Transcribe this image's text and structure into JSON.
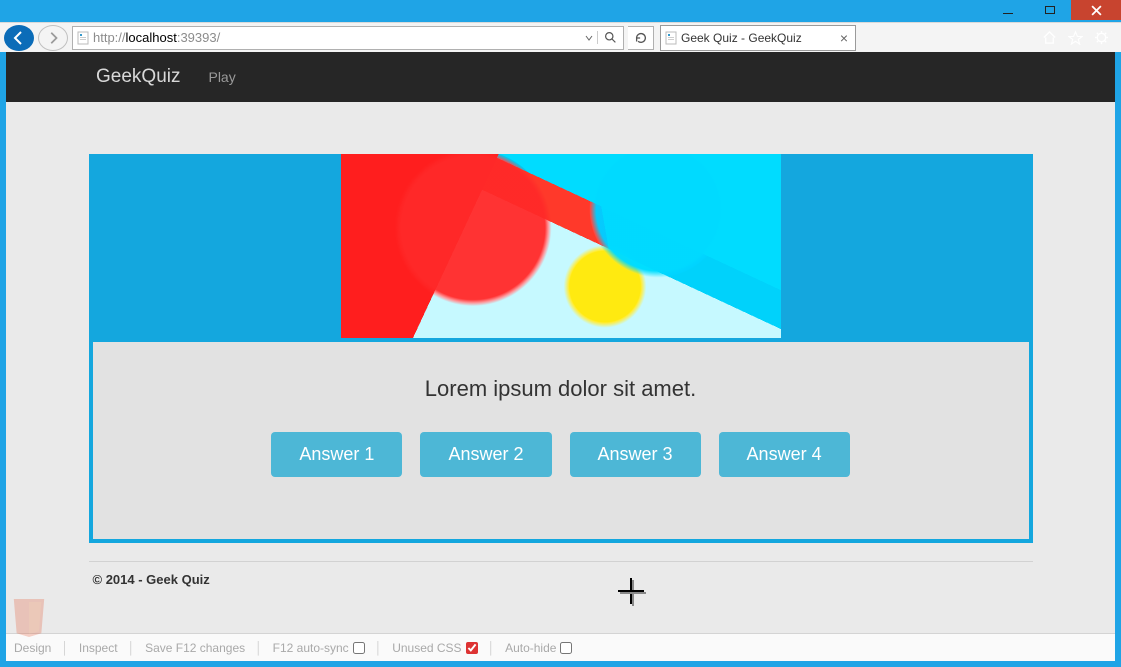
{
  "window": {
    "url_prefix": "http://",
    "url_host": "localhost",
    "url_port": ":39393/",
    "tab_title": "Geek Quiz - GeekQuiz"
  },
  "page": {
    "brand": "GeekQuiz",
    "nav_play": "Play",
    "question": "Lorem ipsum dolor sit amet.",
    "answers": [
      "Answer 1",
      "Answer 2",
      "Answer 3",
      "Answer 4"
    ],
    "footer": "© 2014 - Geek Quiz"
  },
  "devbar": {
    "design": "Design",
    "inspect": "Inspect",
    "save": "Save F12 changes",
    "autosync": "F12 auto-sync",
    "unused": "Unused CSS",
    "autohide": "Auto-hide",
    "autosync_checked": false,
    "unused_checked": true,
    "autohide_checked": false
  }
}
